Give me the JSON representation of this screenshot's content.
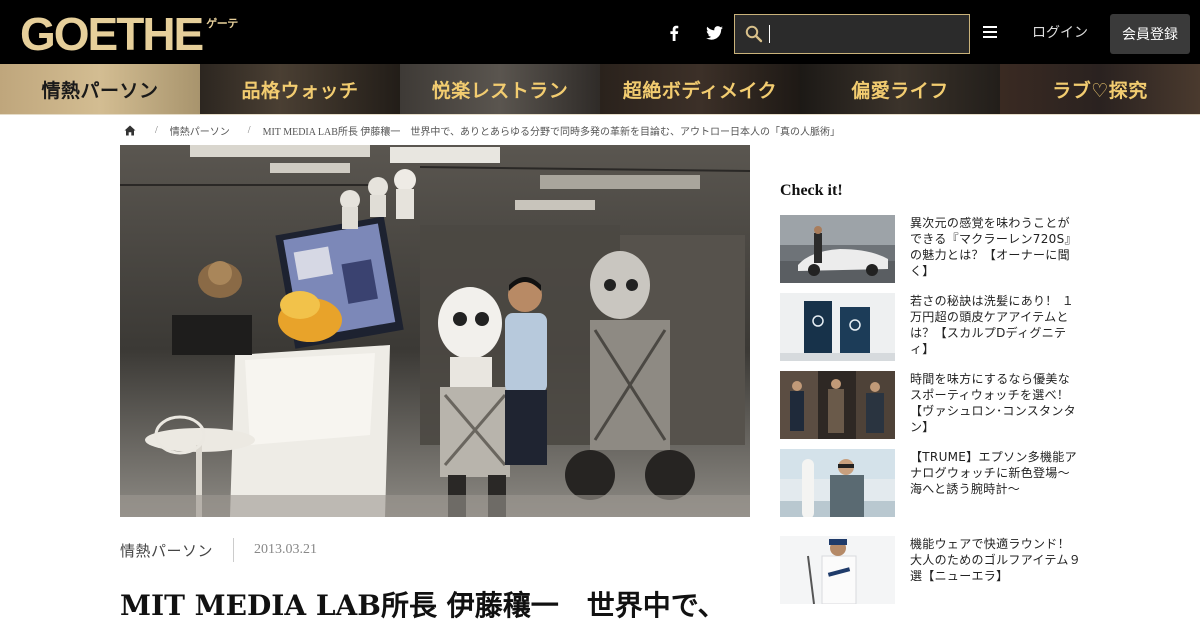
{
  "header": {
    "logo_text": "GOETHE",
    "logo_sub": "ゲーテ",
    "search": {
      "value": "",
      "placeholder": ""
    },
    "login_label": "ログイン",
    "register_label": "会員登録"
  },
  "icons": {
    "facebook": "facebook-icon",
    "twitter": "twitter-icon",
    "search": "search-icon",
    "menu": "menu-icon",
    "home": "home-icon"
  },
  "nav": {
    "categories": [
      {
        "label": "情熱パーソン",
        "active": true
      },
      {
        "label": "品格ウォッチ",
        "active": false
      },
      {
        "label": "悦楽レストラン",
        "active": false
      },
      {
        "label": "超絶ボディメイク",
        "active": false
      },
      {
        "label": "偏愛ライフ",
        "active": false
      },
      {
        "label": "ラブ♡探究",
        "active": false
      }
    ]
  },
  "breadcrumb": {
    "separator": "/",
    "category": "情熱パーソン",
    "current": "MIT MEDIA LAB所長 伊藤穰一　世界中で、ありとあらゆる分野で同時多発の革新を目論む、アウトロー日本人の「真の人脈術」"
  },
  "article": {
    "category": "情熱パーソン",
    "date": "2013.03.21",
    "title": "MIT MEDIA LAB所長 伊藤穰一　世界中で、"
  },
  "sidebar": {
    "heading": "Check it!",
    "items": [
      {
        "text": "異次元の感覚を味わうことができる『マクラーレン720S』の魅力とは？【オーナーに聞く】"
      },
      {
        "text": "若さの秘訣は洗髪にあり！ １万円超の頭皮ケアアイテムとは？【スカルプDディグニティ】"
      },
      {
        "text": "時間を味方にするなら優美なスポーティウォッチを選べ！【ヴァシュロン･コンスタンタン】"
      },
      {
        "text": "【TRUME】エプソン多機能アナログウォッチに新色登場～海へと誘う腕時計～"
      },
      {
        "text": "機能ウェアで快適ラウンド！ 大人のためのゴルフアイテム９選【ニューエラ】"
      }
    ]
  },
  "colors": {
    "header_bg": "#000000",
    "gold": "#e6cf9a",
    "nav_text": "#f2cc70",
    "active_tab": "#c9b28a"
  }
}
